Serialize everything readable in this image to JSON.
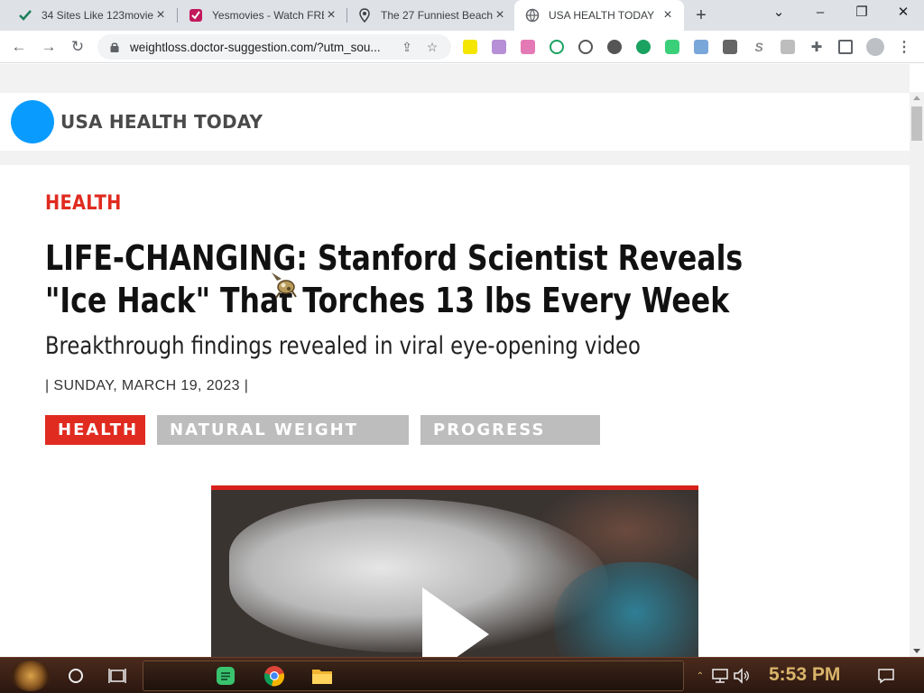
{
  "browser": {
    "tabs": [
      {
        "title": "34 Sites Like 123movies",
        "icon": "checkmark-icon",
        "active": false
      },
      {
        "title": "Yesmovies - Watch FRE",
        "icon": "yesmovies-icon",
        "active": false
      },
      {
        "title": "The 27 Funniest Beach",
        "icon": "map-pin-icon",
        "active": false
      },
      {
        "title": "USA HEALTH TODAY",
        "icon": "globe-icon",
        "active": true
      }
    ],
    "new_tab_label": "+",
    "url": "weightloss.doctor-suggestion.com/?utm_sou..."
  },
  "site": {
    "logo_text": "USA HEALTH TODAY",
    "brand_color": "#0a9bff"
  },
  "article": {
    "category": "HEALTH",
    "headline": "LIFE-CHANGING: Stanford Scientist Reveals \"Ice Hack\" That Torches 13 lbs Every Week",
    "subheadline": "Breakthrough findings revealed in viral eye-opening video",
    "date": "| SUNDAY, MARCH 19, 2023 |",
    "tags": [
      "HEALTH",
      "NATURAL WEIGHT LOSS",
      "PROGRESS PICS"
    ],
    "accent_color": "#e02b20"
  },
  "taskbar": {
    "clock": "5:53 PM"
  }
}
